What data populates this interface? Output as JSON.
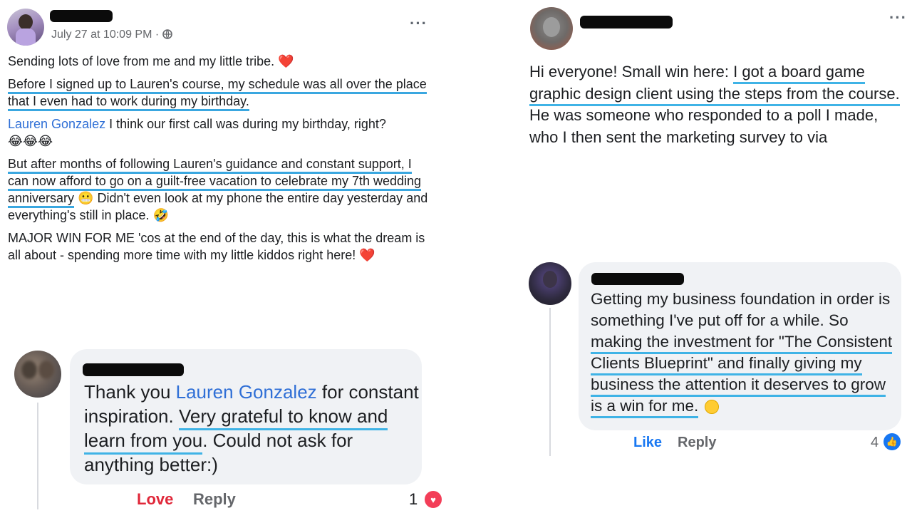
{
  "post1": {
    "timestamp": "July 27 at 10:09 PM",
    "privacy_icon": "globe-icon",
    "line1": "Sending lots of love from me and my little tribe.",
    "para2": "Before I signed up to Lauren's course, my schedule was all over the place that I even had to work during my birthday.",
    "mention": "Lauren Gonzalez",
    "para3_rest": "I think our first call was during my birthday, right?",
    "para4_highlight": "But after months of following Lauren's guidance and constant support, I can now afford to go on a guilt-free vacation to celebrate my 7th wedding anniversary",
    "para4_rest": "Didn't even look at my phone the entire day yesterday and everything's still in place.",
    "para5": "MAJOR WIN FOR ME 'cos at the end of the day, this is what the dream is all about - spending more time with my little kiddos right here!"
  },
  "comment1": {
    "pre": "Thank you",
    "mention": "Lauren Gonzalez",
    "mid": "for constant inspiration.",
    "highlight": "Very grateful to know and learn from you",
    "post": ". Could not ask for anything better:)",
    "actions": {
      "love": "Love",
      "reply": "Reply"
    },
    "reaction_count": "1"
  },
  "post2": {
    "text_pre": "Hi everyone! Small win here:",
    "highlight": "I got a board game graphic design client using the steps from the course.",
    "text_post": "He was someone who responded to a poll I made, who I then sent the marketing survey to via"
  },
  "comment2": {
    "pre": "Getting my business foundation in order is something I've put off for a while. So",
    "highlight": "making the investment for \"The Consistent Clients Blueprint\" and finally giving my business the attention it deserves to grow is a win for me.",
    "actions": {
      "like": "Like",
      "reply": "Reply"
    },
    "reaction_count": "4"
  },
  "colors": {
    "highlight_underline": "#3aa7e0",
    "link": "#2f6fd6",
    "love": "#e0283a",
    "like_blue": "#1877f2",
    "bubble": "#f0f2f5"
  }
}
